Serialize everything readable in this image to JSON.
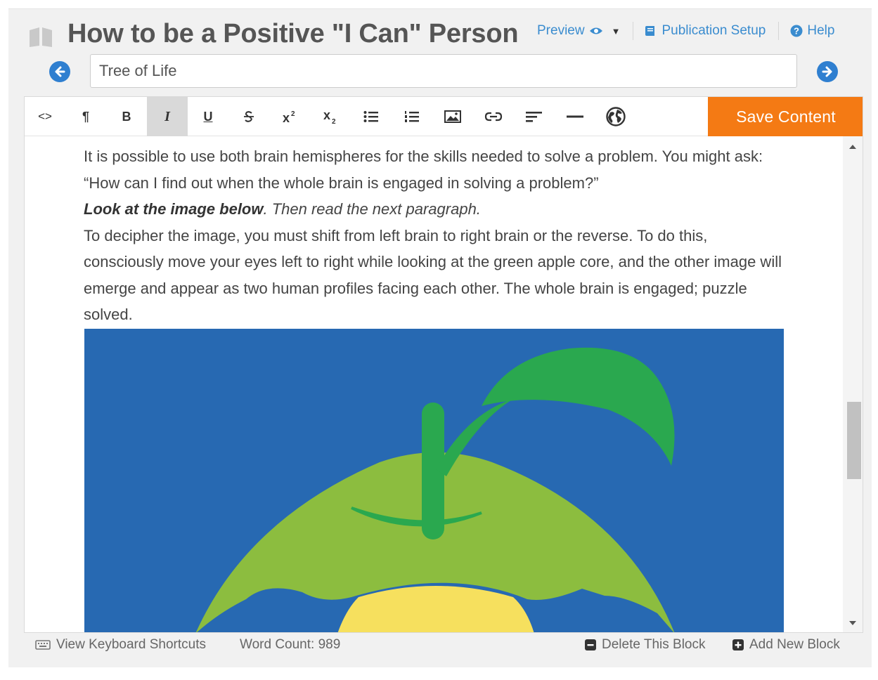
{
  "header": {
    "title": "How to be a Positive \"I Can\" Person",
    "preview_label": "Preview",
    "publication_setup_label": "Publication Setup",
    "help_label": "Help"
  },
  "block": {
    "title_value": "Tree of Life"
  },
  "toolbar": {
    "code_label": "<>",
    "paragraph_label": "¶",
    "bold_label": "B",
    "italic_label": "I",
    "underline_label": "U",
    "save_label": "Save Content"
  },
  "content": {
    "p1": "It is possible to use both brain hemispheres for the skills needed to solve a problem. You might ask: “How can I find out when the whole brain is engaged in solving a problem?”",
    "p2_bold": "Look at the image below",
    "p2_rest": ". Then read the next paragraph.",
    "p3": "To decipher the image, you must shift from left brain to right brain or the reverse. To do this, consciously move your eyes left to right while looking at the green apple core, and the other image will emerge and appear as two human profiles facing each other. The whole brain is engaged; puzzle solved."
  },
  "footer": {
    "shortcuts_label": "View Keyboard Shortcuts",
    "word_count_label": "Word Count: 989",
    "delete_label": "Delete This Block",
    "add_label": "Add New Block"
  },
  "colors": {
    "accent_orange": "#f47a14",
    "link_blue": "#3a8ccf",
    "image_blue": "#2769b2",
    "apple_green": "#8cbd3f",
    "stem_green": "#2aa84f",
    "core_yellow": "#f6e05e"
  },
  "icons": [
    "book-icon",
    "eye-icon",
    "caret-down-icon",
    "book-open-icon",
    "question-circle-icon",
    "arrow-left-circle-icon",
    "arrow-right-circle-icon",
    "keyboard-icon",
    "minus-square-icon",
    "plus-square-icon",
    "globe-icon"
  ]
}
